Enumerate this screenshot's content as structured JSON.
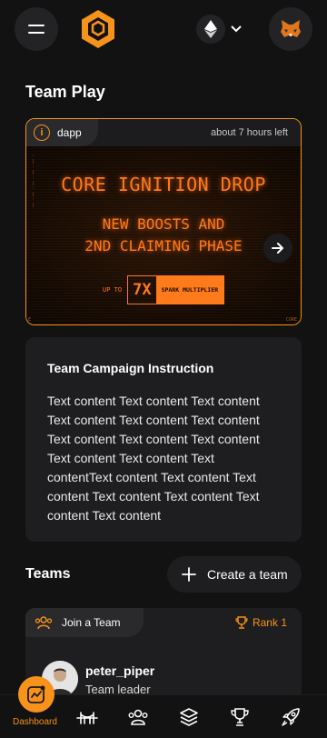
{
  "section": {
    "team_play": "Team Play",
    "teams": "Teams"
  },
  "campaign": {
    "tag": "dapp",
    "time_left": "about 7 hours left",
    "banner": {
      "title": "CORE IGNITION DROP",
      "line1": "NEW BOOSTS AND",
      "line2": "2ND CLAIMING PHASE",
      "up_to": "UP TO",
      "multiplier": "7X",
      "multiplier_label": "SPARK MULTIPLIER",
      "corner_left": "E",
      "corner_right": "CORE"
    }
  },
  "instruction": {
    "title": "Team Campaign Instruction",
    "body": "Text content Text content Text content Text content Text content Text content Text content Text content Text content Text content Text content Text contentText content Text content Text content Text content Text content Text content Text content"
  },
  "teams": {
    "create_label": "Create a team",
    "card": {
      "join_label": "Join a Team",
      "rank_label": "Rank 1",
      "username": "peter_piper",
      "role": "Team leader"
    }
  },
  "nav": {
    "dashboard_label": "Dashboard"
  },
  "colors": {
    "accent": "#f7931a",
    "background": "#121212",
    "card": "#1e1e20"
  }
}
